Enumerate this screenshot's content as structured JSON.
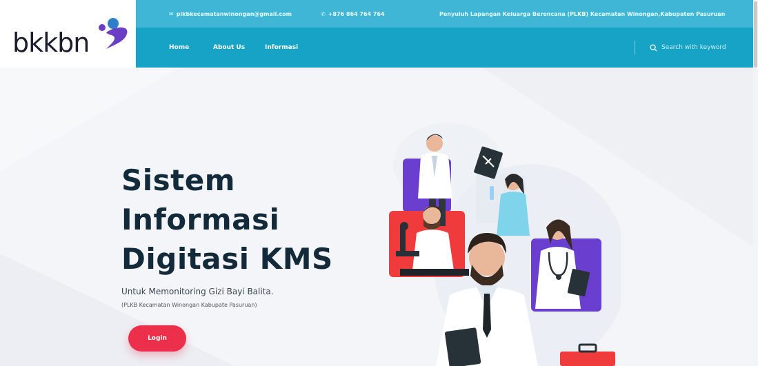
{
  "brand": {
    "logo_text": "bkkbn",
    "logo_icon": "bkkbn-logo-mark-icon",
    "colors": {
      "dark": "#1c1c2c",
      "blue": "#2f7fc8",
      "purple": "#6a3fc4"
    }
  },
  "topbar": {
    "email": "plkbkecamatanwinongan@gmail.com",
    "email_icon": "mail-icon",
    "phone": "+876 864 764 764",
    "phone_icon": "phone-icon",
    "tagline": "Penyuluh Lapangan Keluarga Berencana (PLKB) Kecamatan Winongan,Kabupaten Pasuruan"
  },
  "nav": {
    "items": [
      {
        "label": "Home"
      },
      {
        "label": "About Us"
      },
      {
        "label": "Informasi"
      }
    ],
    "search": {
      "placeholder": "Search with keyword",
      "icon": "search-icon"
    }
  },
  "hero": {
    "title_lines": [
      "Sistem",
      "Informasi",
      "Digitasi KMS"
    ],
    "subtitle": "Untuk Memonitoring Gizi Bayi Balita.",
    "note": "(PLKB Kecamatan Winongan Kabupate Pasuruan)",
    "login_label": "Login",
    "illustration": "medical-professionals-illustration"
  },
  "colors": {
    "header": "#16a3c6",
    "topbar": "#3fb6d6",
    "hero_bg": "#f4f5f8",
    "title": "#122a3a",
    "login": "#ec2f4b"
  }
}
